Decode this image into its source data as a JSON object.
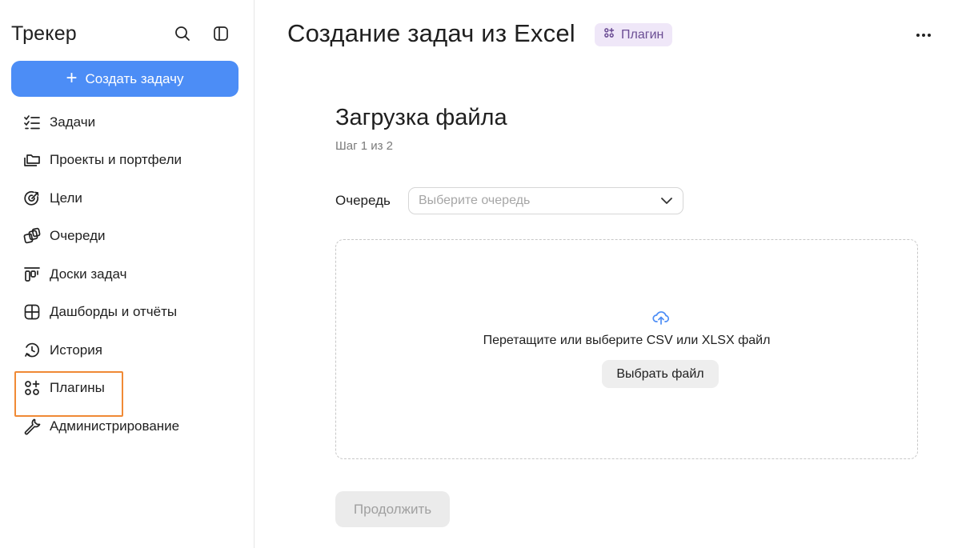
{
  "sidebar": {
    "title": "Трекер",
    "search_icon": "search-icon",
    "collapse_icon": "sidebar-toggle-icon",
    "create_button": {
      "label": "Создать задачу",
      "icon": "plus-icon",
      "color": "#4c8df6"
    },
    "items": [
      {
        "label": "Задачи",
        "icon": "task-list-icon"
      },
      {
        "label": "Проекты и портфели",
        "icon": "folder-stack-icon"
      },
      {
        "label": "Цели",
        "icon": "target-icon"
      },
      {
        "label": "Очереди",
        "icon": "queues-icon"
      },
      {
        "label": "Доски задач",
        "icon": "board-icon"
      },
      {
        "label": "Дашборды и отчёты",
        "icon": "dashboard-icon"
      },
      {
        "label": "История",
        "icon": "history-icon"
      },
      {
        "label": "Плагины",
        "icon": "plugins-icon",
        "highlighted": true
      },
      {
        "label": "Администрирование",
        "icon": "wrench-icon"
      }
    ],
    "highlight_color": "#f08a35"
  },
  "header": {
    "title": "Создание задач из Excel",
    "badge": {
      "label": "Плагин",
      "icon": "plugins-icon",
      "bg": "#efe7f8",
      "color": "#6b4d94"
    },
    "more_icon": "more-icon"
  },
  "form": {
    "section_title": "Загрузка файла",
    "step": "Шаг 1 из 2",
    "queue": {
      "label": "Очередь",
      "placeholder": "Выберите очередь"
    },
    "dropzone": {
      "icon": "upload-cloud-icon",
      "text": "Перетащите или выберите CSV или XLSX файл",
      "button": "Выбрать файл"
    },
    "continue_button": "Продолжить"
  }
}
